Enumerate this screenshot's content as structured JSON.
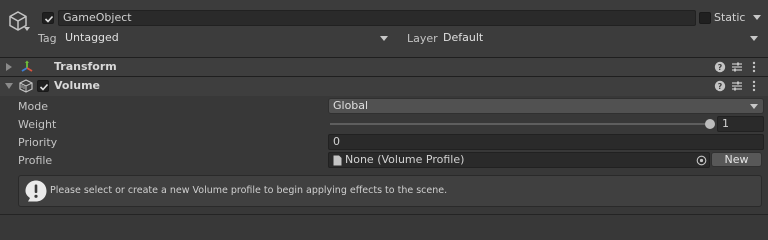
{
  "game_object": {
    "active": true,
    "name": "GameObject",
    "static_label": "Static",
    "static_checked": false,
    "tag_label": "Tag",
    "tag_value": "Untagged",
    "layer_label": "Layer",
    "layer_value": "Default"
  },
  "components": {
    "transform": {
      "title": "Transform",
      "expanded": false
    },
    "volume": {
      "title": "Volume",
      "enabled": true,
      "expanded": true,
      "mode_label": "Mode",
      "mode_value": "Global",
      "weight_label": "Weight",
      "weight_value": "1",
      "weight_fraction": 1.0,
      "priority_label": "Priority",
      "priority_value": "0",
      "profile_label": "Profile",
      "profile_value": "None (Volume Profile)",
      "new_button": "New"
    }
  },
  "help_box": {
    "message": "Please select or create a new Volume profile to begin applying effects to the scene."
  }
}
